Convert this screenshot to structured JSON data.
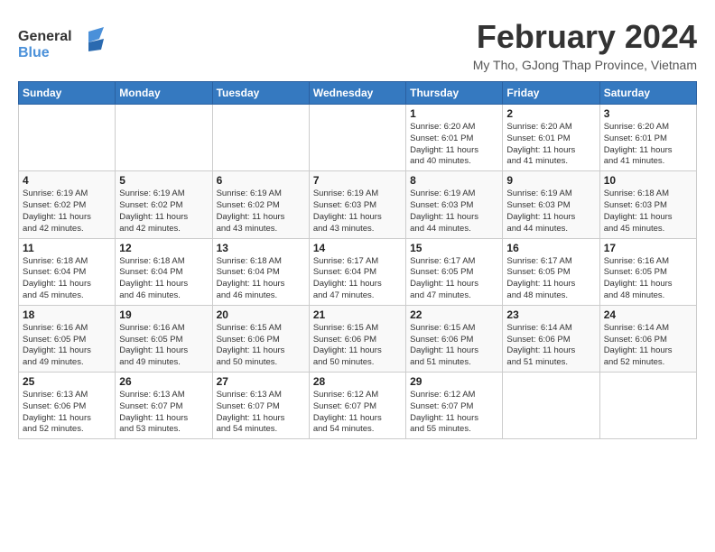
{
  "logo": {
    "line1": "General",
    "line2": "Blue"
  },
  "title": {
    "month_year": "February 2024",
    "location": "My Tho, GJong Thap Province, Vietnam"
  },
  "days_of_week": [
    "Sunday",
    "Monday",
    "Tuesday",
    "Wednesday",
    "Thursday",
    "Friday",
    "Saturday"
  ],
  "weeks": [
    [
      {
        "day": "",
        "info": ""
      },
      {
        "day": "",
        "info": ""
      },
      {
        "day": "",
        "info": ""
      },
      {
        "day": "",
        "info": ""
      },
      {
        "day": "1",
        "info": "Sunrise: 6:20 AM\nSunset: 6:01 PM\nDaylight: 11 hours\nand 40 minutes."
      },
      {
        "day": "2",
        "info": "Sunrise: 6:20 AM\nSunset: 6:01 PM\nDaylight: 11 hours\nand 41 minutes."
      },
      {
        "day": "3",
        "info": "Sunrise: 6:20 AM\nSunset: 6:01 PM\nDaylight: 11 hours\nand 41 minutes."
      }
    ],
    [
      {
        "day": "4",
        "info": "Sunrise: 6:19 AM\nSunset: 6:02 PM\nDaylight: 11 hours\nand 42 minutes."
      },
      {
        "day": "5",
        "info": "Sunrise: 6:19 AM\nSunset: 6:02 PM\nDaylight: 11 hours\nand 42 minutes."
      },
      {
        "day": "6",
        "info": "Sunrise: 6:19 AM\nSunset: 6:02 PM\nDaylight: 11 hours\nand 43 minutes."
      },
      {
        "day": "7",
        "info": "Sunrise: 6:19 AM\nSunset: 6:03 PM\nDaylight: 11 hours\nand 43 minutes."
      },
      {
        "day": "8",
        "info": "Sunrise: 6:19 AM\nSunset: 6:03 PM\nDaylight: 11 hours\nand 44 minutes."
      },
      {
        "day": "9",
        "info": "Sunrise: 6:19 AM\nSunset: 6:03 PM\nDaylight: 11 hours\nand 44 minutes."
      },
      {
        "day": "10",
        "info": "Sunrise: 6:18 AM\nSunset: 6:03 PM\nDaylight: 11 hours\nand 45 minutes."
      }
    ],
    [
      {
        "day": "11",
        "info": "Sunrise: 6:18 AM\nSunset: 6:04 PM\nDaylight: 11 hours\nand 45 minutes."
      },
      {
        "day": "12",
        "info": "Sunrise: 6:18 AM\nSunset: 6:04 PM\nDaylight: 11 hours\nand 46 minutes."
      },
      {
        "day": "13",
        "info": "Sunrise: 6:18 AM\nSunset: 6:04 PM\nDaylight: 11 hours\nand 46 minutes."
      },
      {
        "day": "14",
        "info": "Sunrise: 6:17 AM\nSunset: 6:04 PM\nDaylight: 11 hours\nand 47 minutes."
      },
      {
        "day": "15",
        "info": "Sunrise: 6:17 AM\nSunset: 6:05 PM\nDaylight: 11 hours\nand 47 minutes."
      },
      {
        "day": "16",
        "info": "Sunrise: 6:17 AM\nSunset: 6:05 PM\nDaylight: 11 hours\nand 48 minutes."
      },
      {
        "day": "17",
        "info": "Sunrise: 6:16 AM\nSunset: 6:05 PM\nDaylight: 11 hours\nand 48 minutes."
      }
    ],
    [
      {
        "day": "18",
        "info": "Sunrise: 6:16 AM\nSunset: 6:05 PM\nDaylight: 11 hours\nand 49 minutes."
      },
      {
        "day": "19",
        "info": "Sunrise: 6:16 AM\nSunset: 6:05 PM\nDaylight: 11 hours\nand 49 minutes."
      },
      {
        "day": "20",
        "info": "Sunrise: 6:15 AM\nSunset: 6:06 PM\nDaylight: 11 hours\nand 50 minutes."
      },
      {
        "day": "21",
        "info": "Sunrise: 6:15 AM\nSunset: 6:06 PM\nDaylight: 11 hours\nand 50 minutes."
      },
      {
        "day": "22",
        "info": "Sunrise: 6:15 AM\nSunset: 6:06 PM\nDaylight: 11 hours\nand 51 minutes."
      },
      {
        "day": "23",
        "info": "Sunrise: 6:14 AM\nSunset: 6:06 PM\nDaylight: 11 hours\nand 51 minutes."
      },
      {
        "day": "24",
        "info": "Sunrise: 6:14 AM\nSunset: 6:06 PM\nDaylight: 11 hours\nand 52 minutes."
      }
    ],
    [
      {
        "day": "25",
        "info": "Sunrise: 6:13 AM\nSunset: 6:06 PM\nDaylight: 11 hours\nand 52 minutes."
      },
      {
        "day": "26",
        "info": "Sunrise: 6:13 AM\nSunset: 6:07 PM\nDaylight: 11 hours\nand 53 minutes."
      },
      {
        "day": "27",
        "info": "Sunrise: 6:13 AM\nSunset: 6:07 PM\nDaylight: 11 hours\nand 54 minutes."
      },
      {
        "day": "28",
        "info": "Sunrise: 6:12 AM\nSunset: 6:07 PM\nDaylight: 11 hours\nand 54 minutes."
      },
      {
        "day": "29",
        "info": "Sunrise: 6:12 AM\nSunset: 6:07 PM\nDaylight: 11 hours\nand 55 minutes."
      },
      {
        "day": "",
        "info": ""
      },
      {
        "day": "",
        "info": ""
      }
    ]
  ]
}
